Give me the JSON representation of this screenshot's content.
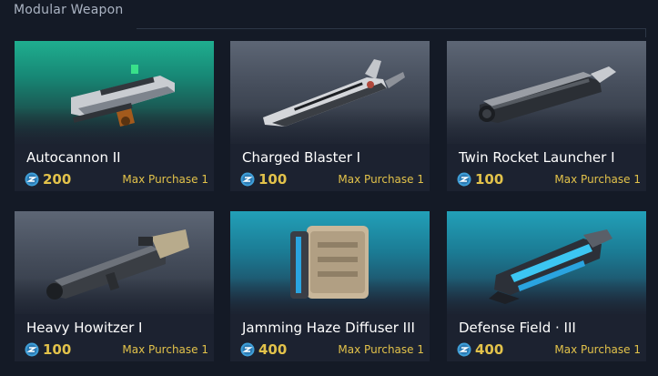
{
  "section": {
    "title": "Modular Weapon"
  },
  "cards": [
    {
      "name": "Autocannon II",
      "price": "200",
      "limit": "Max Purchase 1",
      "icon": "autocannon-icon",
      "theme": "green"
    },
    {
      "name": "Charged Blaster I",
      "price": "100",
      "limit": "Max Purchase 1",
      "icon": "charged-blaster-icon",
      "theme": "grey"
    },
    {
      "name": "Twin Rocket Launcher I",
      "price": "100",
      "limit": "Max Purchase 1",
      "icon": "twin-rocket-launcher-icon",
      "theme": "grey"
    },
    {
      "name": "Heavy Howitzer I",
      "price": "100",
      "limit": "Max Purchase 1",
      "icon": "heavy-howitzer-icon",
      "theme": "grey"
    },
    {
      "name": "Jamming Haze Diffuser III",
      "price": "400",
      "limit": "Max Purchase 1",
      "icon": "jamming-haze-diffuser-icon",
      "theme": "blue"
    },
    {
      "name": "Defense Field · III",
      "price": "400",
      "limit": "Max Purchase 1",
      "icon": "defense-field-icon",
      "theme": "blue"
    }
  ],
  "currency": {
    "icon": "currency-coin-icon"
  },
  "colors": {
    "price": "#e2c24a",
    "coin": "#3f9fd8",
    "background": "#141a26"
  }
}
